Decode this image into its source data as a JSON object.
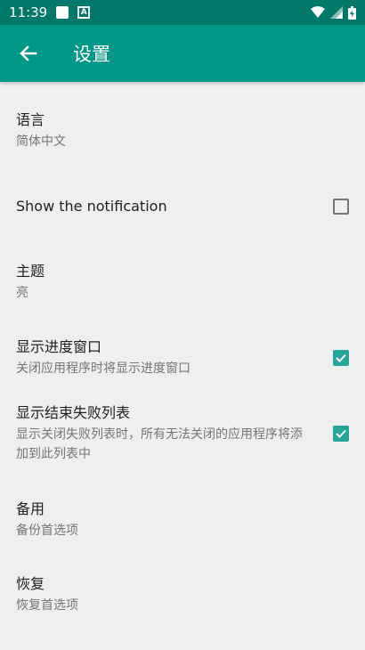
{
  "status_bar": {
    "time": "11:39",
    "notification_letter": "A"
  },
  "app_bar": {
    "title": "设置"
  },
  "colors": {
    "status_bar": "#00796b",
    "app_bar": "#009688",
    "checkbox_checked": "#26a69a",
    "background": "#efefef"
  },
  "preferences": [
    {
      "title": "语言",
      "summary": "简体中文"
    },
    {
      "title": "Show the notification",
      "checked": false
    },
    {
      "title": "主题",
      "summary": "亮"
    },
    {
      "title": "显示进度窗口",
      "summary": "关闭应用程序时将显示进度窗口",
      "checked": true
    },
    {
      "title": "显示结束失败列表",
      "summary": "显示关闭失败列表时，所有无法关闭的应用程序将添加到此列表中",
      "checked": true
    },
    {
      "title": "备用",
      "summary": "备份首选项"
    },
    {
      "title": "恢复",
      "summary": "恢复首选项"
    }
  ]
}
